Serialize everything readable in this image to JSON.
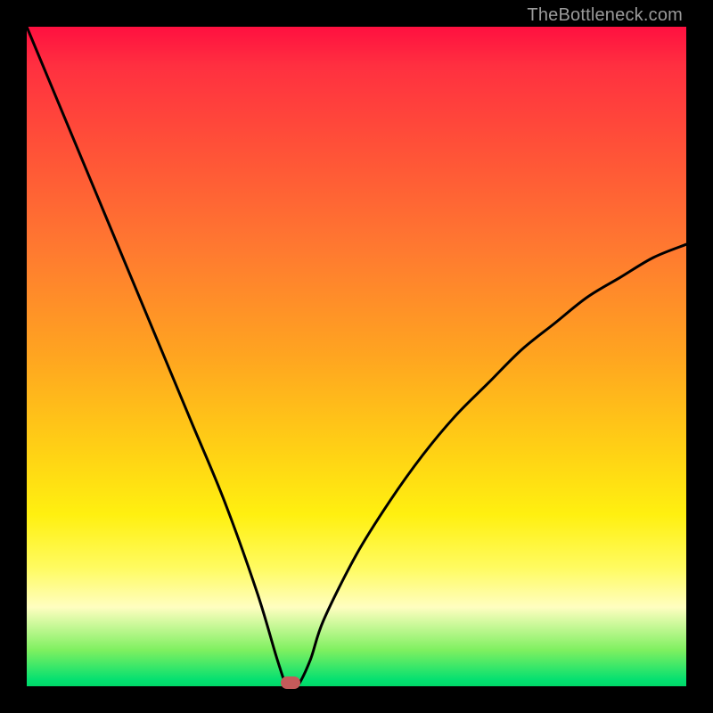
{
  "watermark": "TheBottleneck.com",
  "chart_data": {
    "type": "line",
    "title": "",
    "xlabel": "",
    "ylabel": "",
    "xlim": [
      0,
      100
    ],
    "ylim": [
      0,
      100
    ],
    "series": [
      {
        "name": "bottleneck-curve",
        "x": [
          0,
          5,
          10,
          15,
          20,
          25,
          30,
          35,
          38,
          39.5,
          41,
          43,
          45,
          50,
          55,
          60,
          65,
          70,
          75,
          80,
          85,
          90,
          95,
          100
        ],
        "values": [
          100,
          88,
          76,
          64,
          52,
          40,
          28,
          14,
          4,
          0,
          0,
          4,
          10,
          20,
          28,
          35,
          41,
          46,
          51,
          55,
          59,
          62,
          65,
          67
        ]
      }
    ],
    "marker": {
      "x": 40,
      "y": 0
    },
    "gradient_stops": [
      {
        "pos": 0,
        "color": "#ff1040"
      },
      {
        "pos": 0.5,
        "color": "#ffa520"
      },
      {
        "pos": 0.8,
        "color": "#fff010"
      },
      {
        "pos": 0.94,
        "color": "#7ff060"
      },
      {
        "pos": 1.0,
        "color": "#00d868"
      }
    ]
  }
}
